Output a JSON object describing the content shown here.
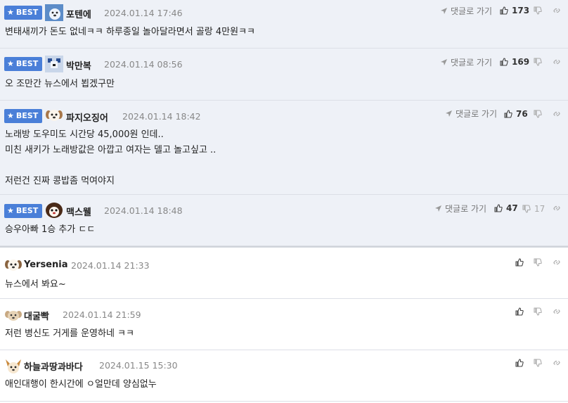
{
  "ui": {
    "best_label": "BEST",
    "go_label": "댓글로 가기"
  },
  "comments": [
    {
      "best": true,
      "nick": "포텐에",
      "date": "2024.01.14 17:46",
      "text": "변태새끼가 돈도 없네ㅋㅋ 하루종일 놀아달라면서 골랑 4만원ㅋㅋ",
      "likes": "173",
      "dislikes": "",
      "avatar": "dog-blue"
    },
    {
      "best": true,
      "nick": "박만복",
      "date": "2024.01.14 08:56",
      "text": "오 조만간 뉴스에서 뵙겠구만",
      "likes": "169",
      "dislikes": "",
      "avatar": "dog-pixel"
    },
    {
      "best": true,
      "nick": "파지오징어",
      "date": "2024.01.14 18:42",
      "text": "노래방 도우미도 시간당 45,000원 인데..\n미친 새키가 노래방값은 아깝고 여자는 델고 놀고싶고 ..\n\n저런건 진짜 콩밥좀 먹여야지",
      "likes": "76",
      "dislikes": "",
      "avatar": "dog-white"
    },
    {
      "best": true,
      "nick": "맥스웰",
      "date": "2024.01.14 18:48",
      "text": "승우아빠 1승 추가 ㄷㄷ",
      "likes": "47",
      "dislikes": "17",
      "avatar": "dog-dark"
    },
    {
      "best": false,
      "nick": "Yersenia",
      "date": "2024.01.14 21:33",
      "text": "뉴스에서 봐요~",
      "likes": "",
      "dislikes": "",
      "avatar": "dog-white"
    },
    {
      "best": false,
      "nick": "대굴빡",
      "date": "2024.01.14 21:59",
      "text": "저런 병신도 거게를 운영하네 ㅋㅋ",
      "likes": "",
      "dislikes": "",
      "avatar": "dog-tan"
    },
    {
      "best": false,
      "nick": "하늘과땅과바다",
      "date": "2024.01.15 15:30",
      "text": "애인대행이 한시간에 ㅇ얼만데 양심없누",
      "likes": "",
      "dislikes": "",
      "avatar": "dog-corgi"
    }
  ],
  "colors": {
    "best_bg": "#eef1f7",
    "badge": "#4a7fd8"
  }
}
